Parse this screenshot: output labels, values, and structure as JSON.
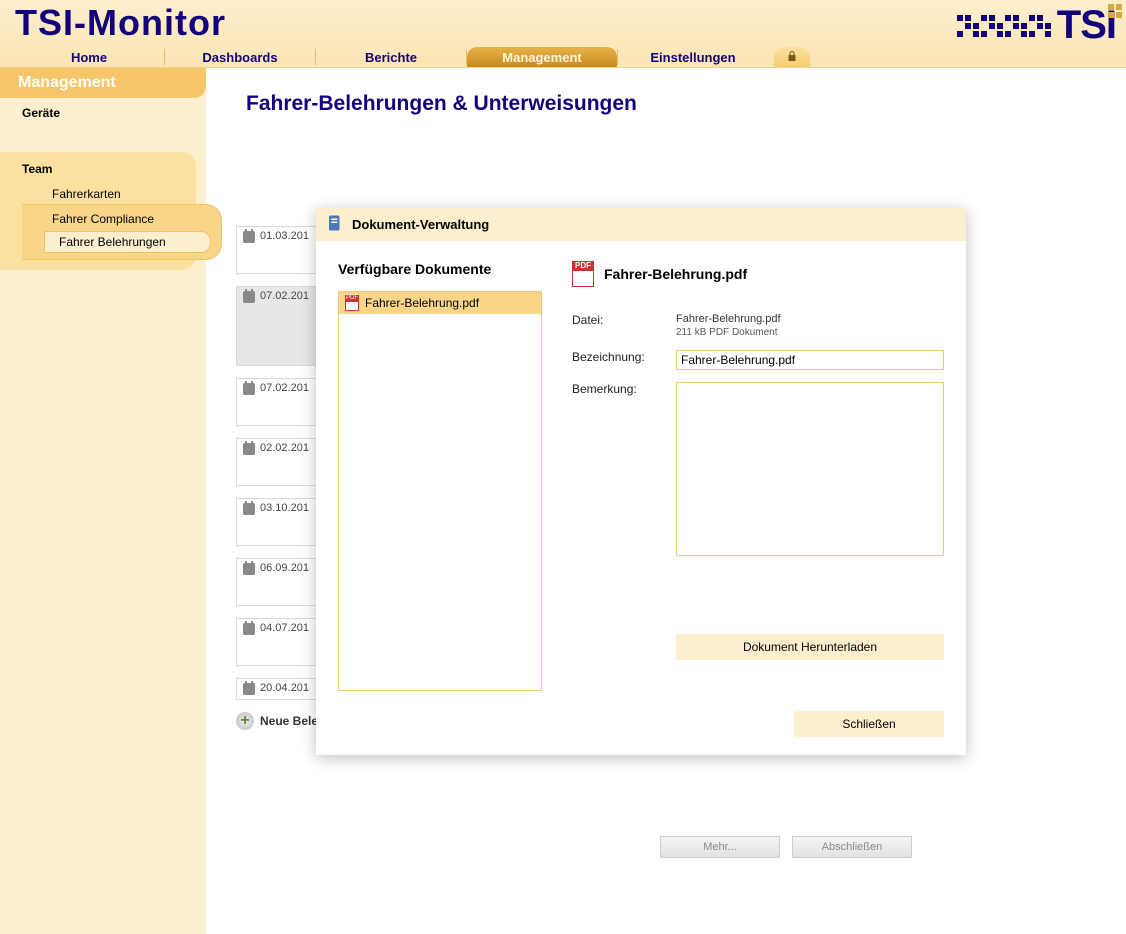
{
  "appTitle": "TSI-Monitor",
  "logoText": "TSI",
  "nav": {
    "home": "Home",
    "dashboards": "Dashboards",
    "berichte": "Berichte",
    "management": "Management",
    "einstellungen": "Einstellungen"
  },
  "sidebar": {
    "section": "Management",
    "geraete": "Geräte",
    "team": "Team",
    "fahrerkarten": "Fahrerkarten",
    "compliance": "Fahrer Compliance",
    "belehrungen": "Fahrer Belehrungen"
  },
  "page": {
    "title": "Fahrer-Belehrungen & Unterweisungen",
    "createLabel": "Neue Belehrung Erstellen",
    "mehr": "Mehr...",
    "abschliessen": "Abschließen"
  },
  "listDates": {
    "d0": "01.03.201",
    "d1": "07.02.201",
    "d2": "07.02.201",
    "d3": "02.02.201",
    "d4": "03.10.201",
    "d5": "06.09.201",
    "d6": "04.07.201",
    "d7": "20.04.201"
  },
  "dialog": {
    "title": "Dokument-Verwaltung",
    "availHeader": "Verfügbare Dokumente",
    "docItem": "Fahrer-Belehrung.pdf",
    "docHeader": "Fahrer-Belehrung.pdf",
    "lblDatei": "Datei:",
    "fileName": "Fahrer-Belehrung.pdf",
    "fileMeta": "211 kB   PDF Dokument",
    "lblBezeichnung": "Bezeichnung:",
    "bezeichnung": "Fahrer-Belehrung.pdf",
    "lblBemerkung": "Bemerkung:",
    "bemerkung": "",
    "download": "Dokument Herunterladen",
    "close": "Schließen"
  }
}
